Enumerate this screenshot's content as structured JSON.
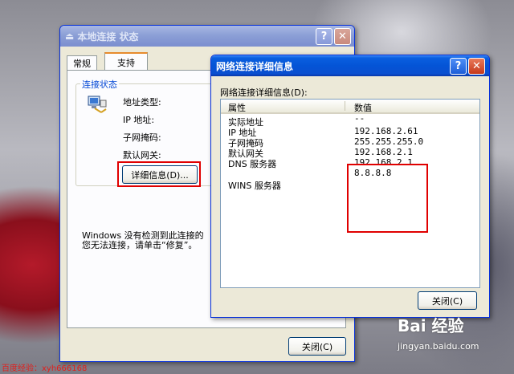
{
  "status_dialog": {
    "title": "本地连接 状态",
    "help_glyph": "?",
    "close_glyph": "✕",
    "tabs": [
      "常规",
      "支持"
    ],
    "group_label": "连接状态",
    "fields": [
      "地址类型:",
      "IP 地址:",
      "子网掩码:",
      "默认网关:"
    ],
    "details_button": "详细信息(D)...",
    "notice_line1": "Windows 没有检测到此连接的",
    "notice_line2": "您无法连接，请单击“修复”。",
    "close_button": "关闭(C)",
    "icon": "network-computer-icon"
  },
  "details_dialog": {
    "title": "网络连接详细信息",
    "help_glyph": "?",
    "close_glyph": "✕",
    "label": "网络连接详细信息(D):",
    "columns": [
      "属性",
      "数值"
    ],
    "rows": [
      {
        "property": "实际地址",
        "value": "--"
      },
      {
        "property": "IP 地址",
        "value": "192.168.2.61"
      },
      {
        "property": "子网掩码",
        "value": "255.255.255.0"
      },
      {
        "property": "默认网关",
        "value": "192.168.2.1"
      },
      {
        "property": "DNS 服务器",
        "value": "192.168.2.1"
      },
      {
        "property": "",
        "value": "8.8.8.8"
      },
      {
        "property": "WINS 服务器",
        "value": ""
      }
    ],
    "close_button": "关闭(C)"
  },
  "watermark": {
    "left_text": "百度经验：xyh666168",
    "logo_text": "Bai 经验",
    "logo_url": "jingyan.baidu.com"
  }
}
